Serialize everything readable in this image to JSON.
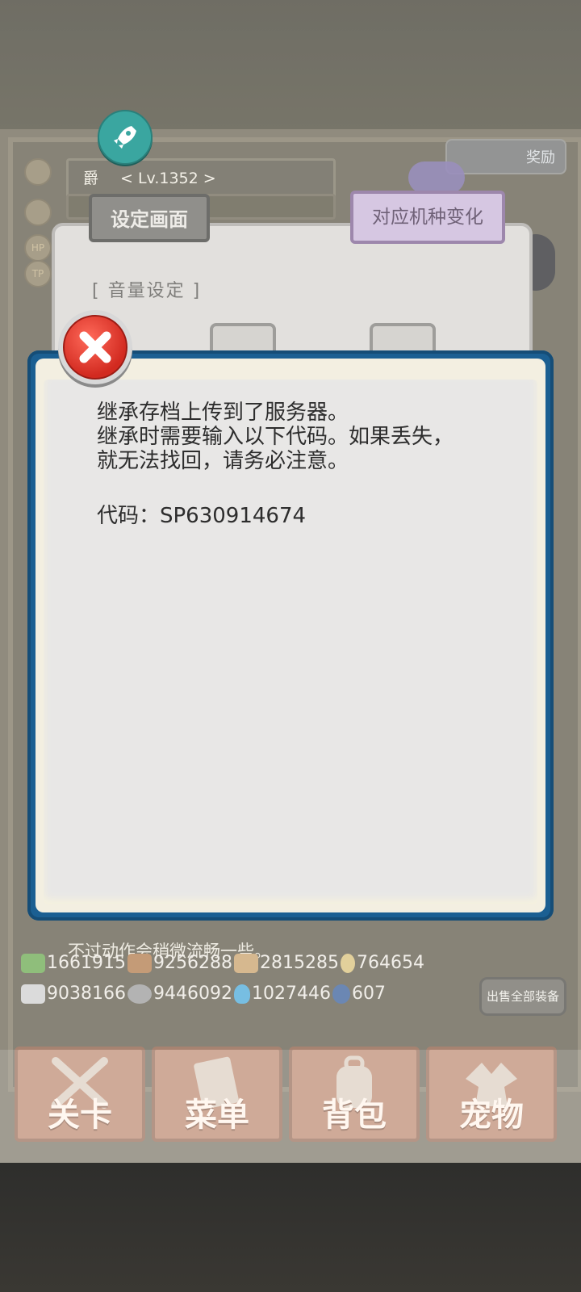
{
  "game": {
    "player": {
      "title": "爵",
      "level": "< Lv.1352 >"
    },
    "status_labels": [
      "HP",
      "TP"
    ],
    "top_badge": "奖励",
    "tabs": {
      "settings": "设定画面",
      "device": "对应机种变化"
    },
    "volume_label": "[ 音量设定 ]",
    "message_bottom": "不过动作会稍微流畅一些。",
    "resources": [
      {
        "icon": "leaf-icon",
        "value": "1661915",
        "color": "#6aa84f"
      },
      {
        "icon": "log-icon",
        "value": "9256288",
        "color": "#b07a4a"
      },
      {
        "icon": "plank-icon",
        "value": "2815285",
        "color": "#c8a06a"
      },
      {
        "icon": "drop-icon",
        "value": "764654",
        "color": "#d9c07a"
      },
      {
        "icon": "ingot-icon",
        "value": "9038166",
        "color": "#cfcfcf"
      },
      {
        "icon": "ore-icon",
        "value": "9446092",
        "color": "#9a9a9a"
      },
      {
        "icon": "flame-icon",
        "value": "1027446",
        "color": "#4aa8d8"
      },
      {
        "icon": "orb-icon",
        "value": "607",
        "color": "#3a5f9a"
      }
    ],
    "sell_all": "出售全部装备",
    "nav": [
      {
        "label": "关卡",
        "icon": "crossed-swords-icon"
      },
      {
        "label": "菜单",
        "icon": "book-icon"
      },
      {
        "label": "背包",
        "icon": "backpack-icon"
      },
      {
        "label": "宠物",
        "icon": "dragon-icon"
      }
    ]
  },
  "dialog": {
    "lines": [
      "继承存档上传到了服务器。",
      "继承时需要输入以下代码。如果丢失，",
      "就无法找回，请务必注意。"
    ],
    "code": "代码：SP630914674"
  },
  "colors": {
    "dialog_border": "#1b5f92",
    "close_red": "#d22a20",
    "rocket_teal": "#3aa6a0"
  }
}
